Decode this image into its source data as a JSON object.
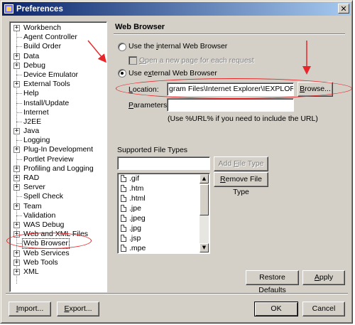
{
  "window": {
    "title": "Preferences",
    "close_glyph": "✕"
  },
  "tree": {
    "items": [
      {
        "label": "Workbench",
        "expandable": true
      },
      {
        "label": "Agent Controller",
        "expandable": false
      },
      {
        "label": "Build Order",
        "expandable": false
      },
      {
        "label": "Data",
        "expandable": true
      },
      {
        "label": "Debug",
        "expandable": true
      },
      {
        "label": "Device Emulator",
        "expandable": false
      },
      {
        "label": "External Tools",
        "expandable": true
      },
      {
        "label": "Help",
        "expandable": false
      },
      {
        "label": "Install/Update",
        "expandable": false
      },
      {
        "label": "Internet",
        "expandable": false
      },
      {
        "label": "J2EE",
        "expandable": false
      },
      {
        "label": "Java",
        "expandable": true
      },
      {
        "label": "Logging",
        "expandable": false
      },
      {
        "label": "Plug-In Development",
        "expandable": true
      },
      {
        "label": "Portlet Preview",
        "expandable": false
      },
      {
        "label": "Profiling and Logging",
        "expandable": true
      },
      {
        "label": "RAD",
        "expandable": true
      },
      {
        "label": "Server",
        "expandable": true
      },
      {
        "label": "Spell Check",
        "expandable": false
      },
      {
        "label": "Team",
        "expandable": true
      },
      {
        "label": "Validation",
        "expandable": false
      },
      {
        "label": "WAS Debug",
        "expandable": true
      },
      {
        "label": "Web and XML Files",
        "expandable": true
      },
      {
        "label": "Web Browser",
        "expandable": false,
        "selected": true
      },
      {
        "label": "Web Services",
        "expandable": true
      },
      {
        "label": "Web Tools",
        "expandable": true
      },
      {
        "label": "XML",
        "expandable": true
      }
    ]
  },
  "pane": {
    "title": "Web Browser",
    "internal_radio": {
      "pre": "Use the ",
      "mn": "i",
      "post": "nternal Web Browser",
      "selected": false
    },
    "new_page_check": {
      "pre": "",
      "mn": "O",
      "post": "pen a new page for each request",
      "checked": false,
      "disabled": true
    },
    "external_radio": {
      "pre": "Use e",
      "mn": "x",
      "post": "ternal Web Browser",
      "selected": true
    },
    "location": {
      "pre": "",
      "mn": "L",
      "post": "ocation:",
      "value": "gram Files\\Internet Explorer\\IEXPLORE.EXE"
    },
    "browse_button": {
      "pre": "",
      "mn": "B",
      "post": "rowse..."
    },
    "parameters": {
      "pre": "",
      "mn": "P",
      "post": "arameters:",
      "value": ""
    },
    "hint": "(Use %URL% if you need to include the URL)",
    "file_types_label": "Supported File Types",
    "new_type_value": "",
    "add_button": {
      "pre": "Add ",
      "mn": "F",
      "post": "ile Type"
    },
    "remove_button": {
      "pre": "",
      "mn": "R",
      "post": "emove File Type"
    },
    "file_types": [
      ".gif",
      ".htm",
      ".html",
      ".jpe",
      ".jpeg",
      ".jpg",
      ".jsp",
      ".mpe"
    ],
    "restore_button": {
      "pre": "Restore ",
      "mn": "D",
      "post": "efaults"
    },
    "apply_button": {
      "pre": "",
      "mn": "A",
      "post": "pply"
    }
  },
  "footer": {
    "import_button": {
      "pre": "",
      "mn": "I",
      "post": "mport..."
    },
    "export_button": {
      "pre": "",
      "mn": "E",
      "post": "xport..."
    },
    "ok_label": "OK",
    "cancel_label": "Cancel"
  },
  "annotation_color": "#e8262a"
}
